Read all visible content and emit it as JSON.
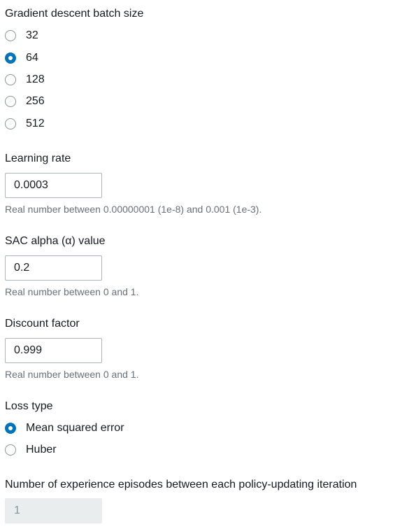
{
  "batch_size": {
    "label": "Gradient descent batch size",
    "options": [
      "32",
      "64",
      "128",
      "256",
      "512"
    ],
    "selected": "64"
  },
  "learning_rate": {
    "label": "Learning rate",
    "value": "0.0003",
    "hint": "Real number between 0.00000001 (1e-8) and 0.001 (1e-3)."
  },
  "sac_alpha": {
    "label": "SAC alpha (α) value",
    "value": "0.2",
    "hint": "Real number between 0 and 1."
  },
  "discount_factor": {
    "label": "Discount factor",
    "value": "0.999",
    "hint": "Real number between 0 and 1."
  },
  "loss_type": {
    "label": "Loss type",
    "options": [
      "Mean squared error",
      "Huber"
    ],
    "selected": "Mean squared error"
  },
  "experience_episodes": {
    "label": "Number of experience episodes between each policy-updating iteration",
    "value": "1"
  },
  "colors": {
    "accent": "#0073bb",
    "text": "#16191f",
    "hint": "#687078",
    "border": "#aab7b8",
    "disabled_bg": "#eaeded"
  }
}
